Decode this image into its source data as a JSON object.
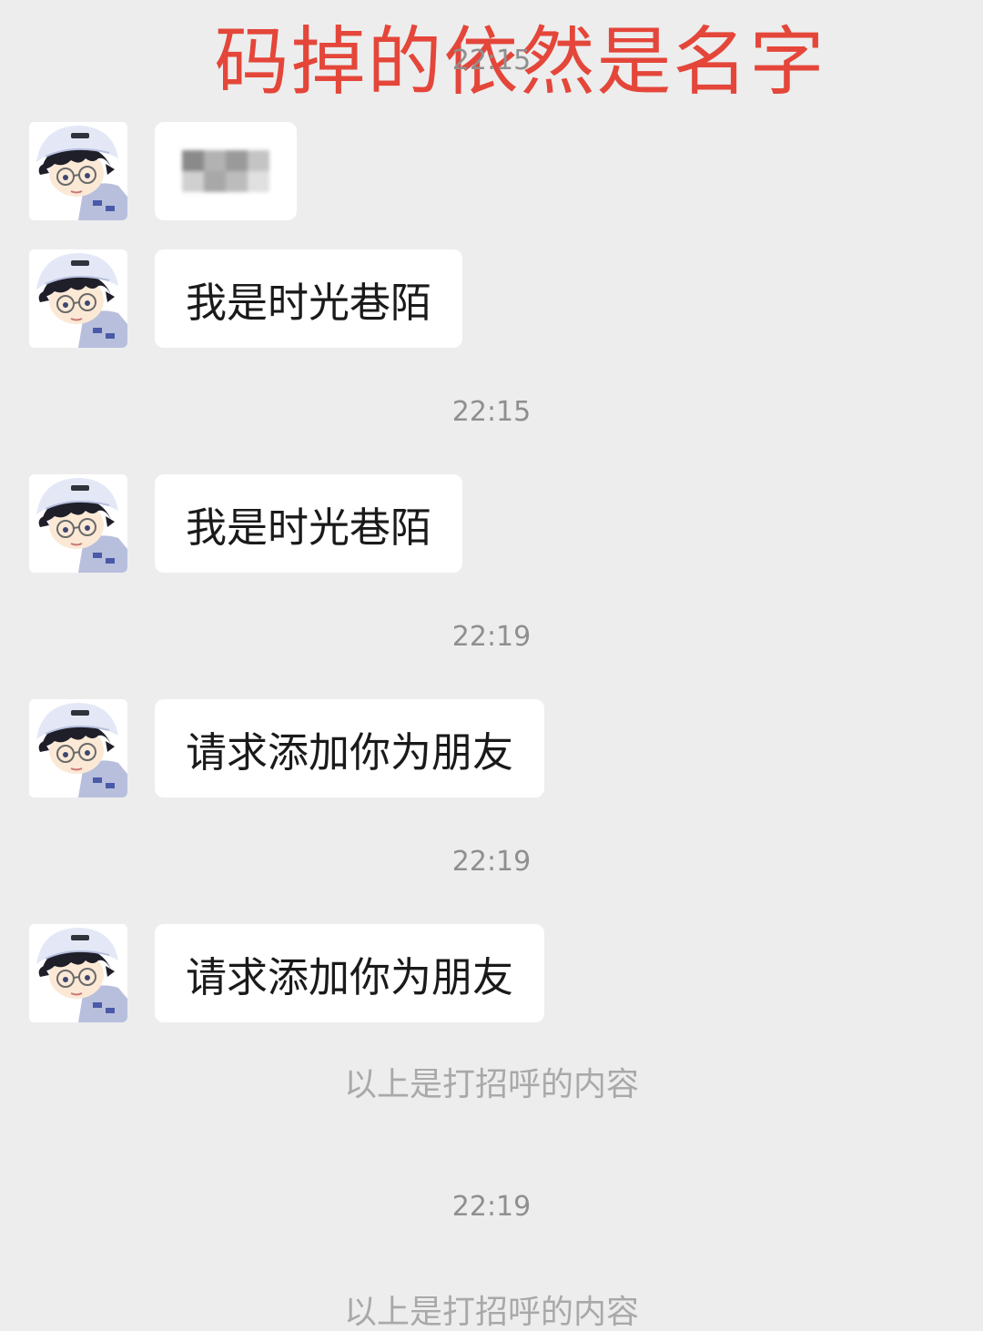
{
  "overlay": {
    "title": "码掉的依然是名字"
  },
  "timestamps": [
    "22:15",
    "22:15",
    "22:19",
    "22:19",
    "22:19"
  ],
  "messages": [
    {
      "text": "",
      "blurred": true
    },
    {
      "text": "我是时光巷陌"
    },
    {
      "text": "我是时光巷陌"
    },
    {
      "text": "请求添加你为朋友"
    },
    {
      "text": "请求添加你为朋友"
    }
  ],
  "system": [
    "以上是打招呼的内容",
    "以上是打招呼的内容"
  ],
  "avatar": {
    "icon": "user-avatar-icon"
  },
  "colors": {
    "background": "#ededed",
    "bubble": "#ffffff",
    "overlay_text": "#e4463a",
    "timestamp_text": "#8f8f8f",
    "system_text": "#a9a9a9"
  }
}
